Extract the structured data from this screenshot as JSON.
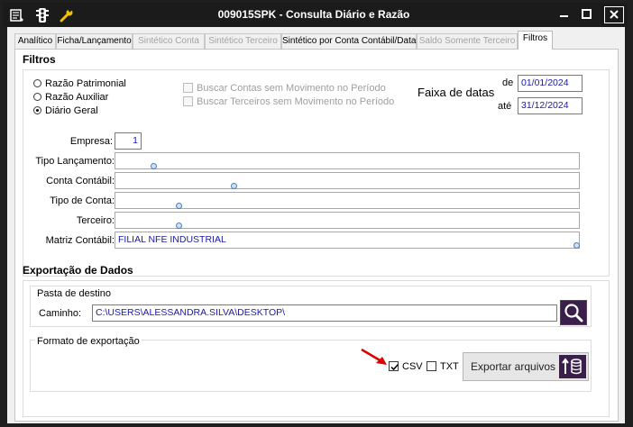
{
  "window": {
    "title": "009015SPK - Consulta Diário e Razão",
    "icons": [
      "menu-list-icon",
      "traffic-light-icon",
      "wrench-icon"
    ],
    "controls": [
      "minimize",
      "maximize",
      "close"
    ]
  },
  "tabs": [
    {
      "label": "Analítico",
      "state": "enabled"
    },
    {
      "label": "Ficha/Lançamento",
      "state": "enabled"
    },
    {
      "label": "Sintético Conta",
      "state": "disabled"
    },
    {
      "label": "Sintético Terceiro",
      "state": "disabled"
    },
    {
      "label": "Sintético por Conta Contábil/Data",
      "state": "enabled"
    },
    {
      "label": "Saldo Somente Terceiro",
      "state": "disabled"
    },
    {
      "label": "Filtros",
      "state": "active"
    }
  ],
  "filtros": {
    "title": "Filtros",
    "radios": [
      {
        "label": "Razão Patrimonial",
        "checked": false
      },
      {
        "label": "Razão Auxiliar",
        "checked": false
      },
      {
        "label": "Diário Geral",
        "checked": true
      }
    ],
    "checkboxes": [
      {
        "label": "Buscar Contas sem Movimento no Período",
        "checked": false
      },
      {
        "label": "Buscar Terceiros sem Movimento no Período",
        "checked": false
      }
    ],
    "date_range": {
      "label": "Faixa de datas",
      "from_label": "de",
      "from_value": "01/01/2024",
      "to_label": "até",
      "to_value": "31/12/2024"
    },
    "fields": {
      "empresa_label": "Empresa:",
      "empresa_value": "1",
      "tipo_lancamento_label": "Tipo Lançamento:",
      "tipo_lancamento_value": "",
      "conta_contabil_label": "Conta Contábil:",
      "conta_contabil_value": "",
      "tipo_conta_label": "Tipo de Conta:",
      "tipo_conta_value": "",
      "terceiro_label": "Terceiro:",
      "terceiro_value": "",
      "matriz_label": "Matriz Contábil:",
      "matriz_value": "FILIAL NFE INDUSTRIAL"
    }
  },
  "exportacao": {
    "title": "Exportação de Dados",
    "pasta": {
      "legend": "Pasta de destino",
      "caminho_label": "Caminho:",
      "caminho_value": "C:\\USERS\\ALESSANDRA.SILVA\\DESKTOP\\"
    },
    "formato": {
      "legend": "Formato de exportação",
      "csv_label": "CSV",
      "csv_checked": true,
      "txt_label": "TXT",
      "txt_checked": false,
      "export_button": "Exportar arquivos"
    }
  },
  "colors": {
    "titlebar": "#1b1b1b",
    "input_text": "#1a1aa8",
    "search_button": "#3a1f4a",
    "arrow": "#e00000"
  }
}
